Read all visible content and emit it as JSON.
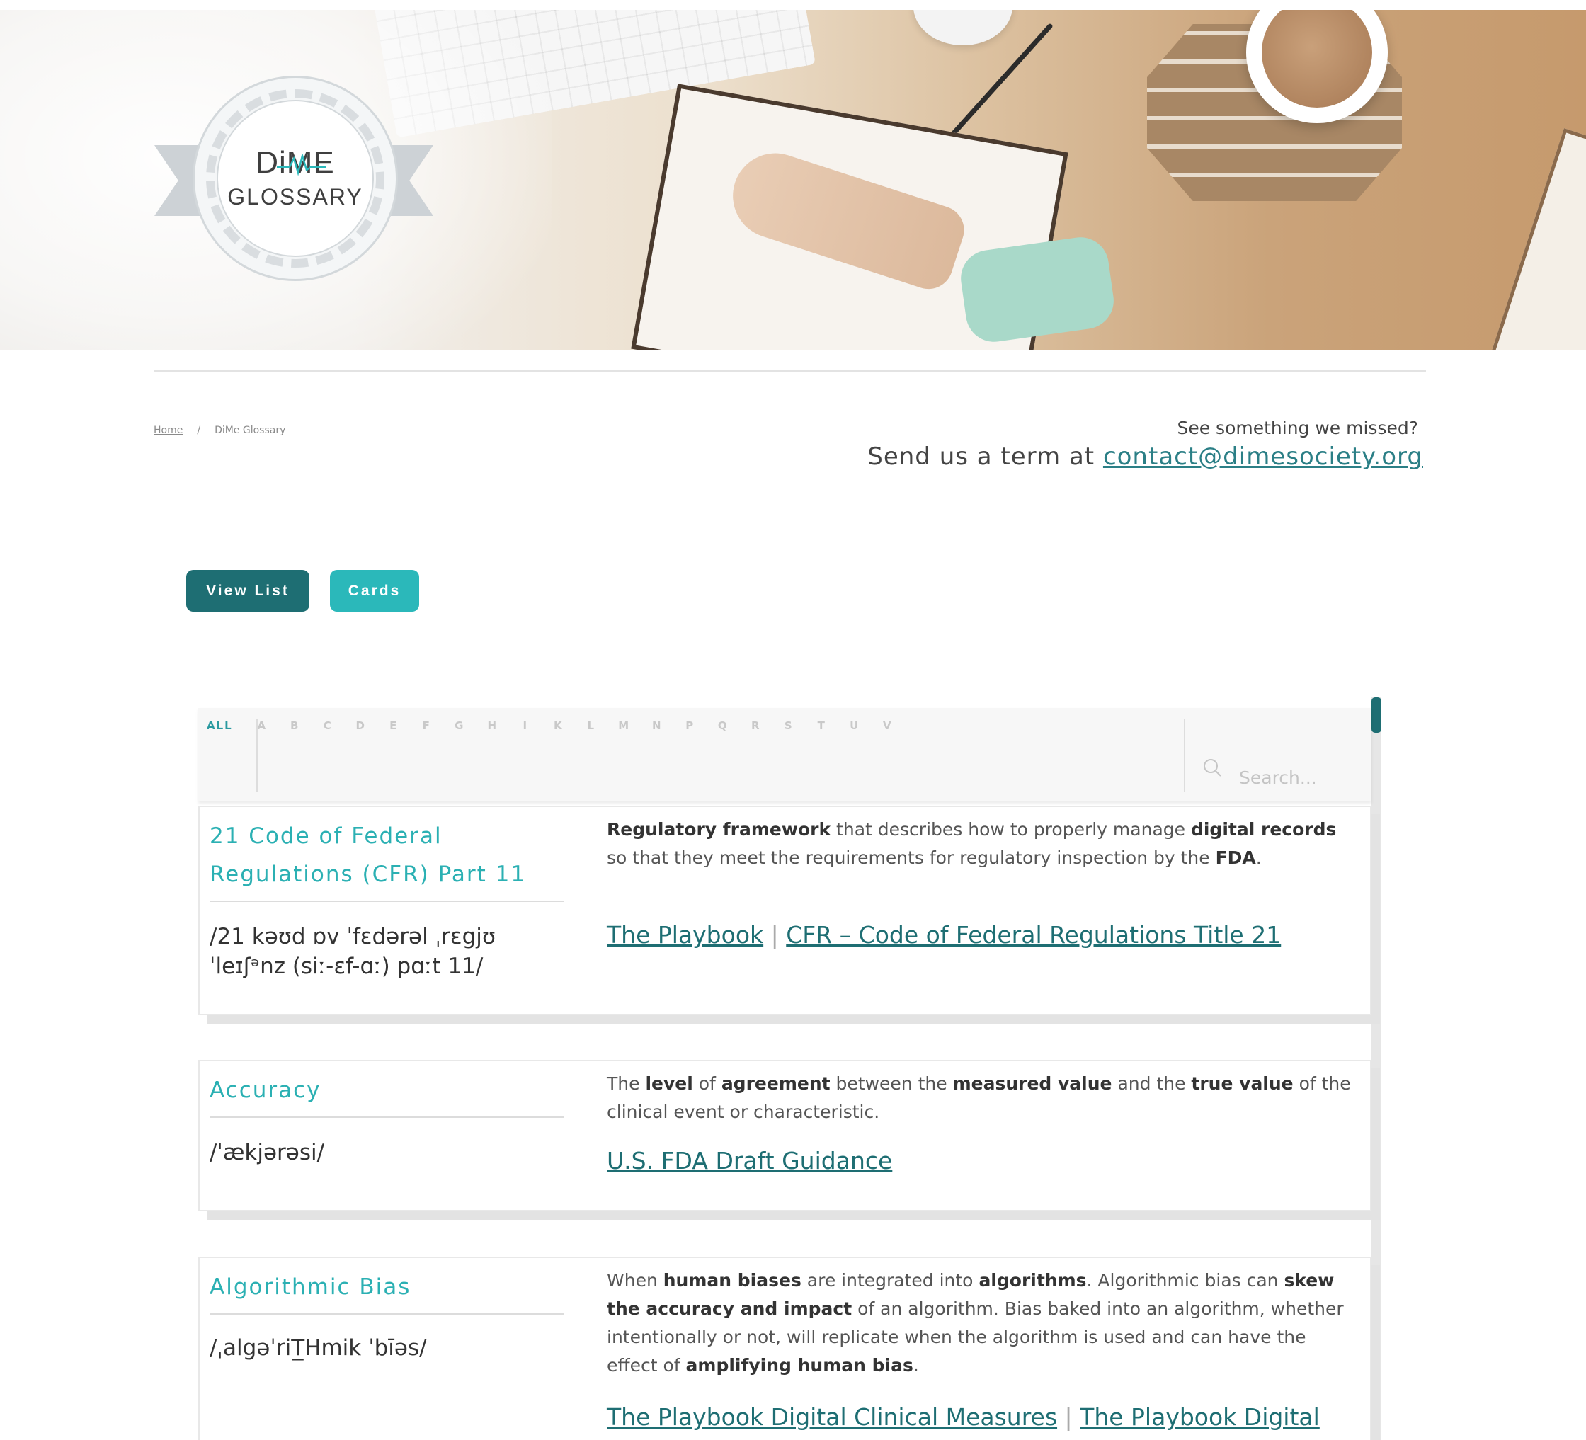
{
  "hero": {
    "logo_top": "DiME",
    "logo_bottom": "GLOSSARY"
  },
  "breadcrumb": {
    "home": "Home",
    "separator": "/",
    "current": "DiMe Glossary"
  },
  "contact": {
    "question": "See something we missed?",
    "prefix": "Send us a term at",
    "email": "contact@dimesociety.org"
  },
  "views": {
    "list_label": "View List",
    "cards_label": "Cards"
  },
  "filter": {
    "all_label": "ALL",
    "letters": [
      "A",
      "B",
      "C",
      "D",
      "E",
      "F",
      "G",
      "H",
      "I",
      "K",
      "L",
      "M",
      "N",
      "P",
      "Q",
      "R",
      "S",
      "T",
      "U",
      "V"
    ],
    "search_placeholder": "Search..."
  },
  "terms": [
    {
      "term": "21 Code of Federal Regulations (CFR) Part 11",
      "pronunciation": "/21 kəʊd ɒv ˈfɛdərəl ˌrɛgjʊˈleɪʃᵊnz (siː-ɛf-ɑː) pɑːt 11/",
      "definition_parts": [
        {
          "text": "Regulatory framework",
          "bold": true
        },
        {
          "text": " that describes how to properly manage ",
          "bold": false
        },
        {
          "text": "digital records",
          "bold": true
        },
        {
          "text": " so that they meet the requirements for regulatory inspection by the ",
          "bold": false
        },
        {
          "text": "FDA",
          "bold": true
        },
        {
          "text": ".",
          "bold": false
        }
      ],
      "references": [
        "The Playbook",
        "CFR – Code of Federal Regulations Title 21"
      ]
    },
    {
      "term": "Accuracy",
      "pronunciation": "/ˈækjərəsi/",
      "definition_parts": [
        {
          "text": "The ",
          "bold": false
        },
        {
          "text": "level",
          "bold": true
        },
        {
          "text": " of ",
          "bold": false
        },
        {
          "text": "agreement",
          "bold": true
        },
        {
          "text": " between the ",
          "bold": false
        },
        {
          "text": "measured value",
          "bold": true
        },
        {
          "text": " and the ",
          "bold": false
        },
        {
          "text": "true value",
          "bold": true
        },
        {
          "text": " of the clinical event or characteristic.",
          "bold": false
        }
      ],
      "references": [
        "U.S. FDA Draft Guidance"
      ]
    },
    {
      "term": "Algorithmic Bias",
      "pronunciation": "/ˌalgəˈriT̲Hmik ˈbīəs/",
      "definition_parts": [
        {
          "text": "When ",
          "bold": false
        },
        {
          "text": "human biases",
          "bold": true
        },
        {
          "text": " are integrated into ",
          "bold": false
        },
        {
          "text": "algorithms",
          "bold": true
        },
        {
          "text": ". Algorithmic bias can ",
          "bold": false
        },
        {
          "text": "skew the accuracy and impact",
          "bold": true
        },
        {
          "text": " of an algorithm. Bias baked into an algorithm, whether intentionally or not, will replicate when the algorithm is used and can have the effect of ",
          "bold": false
        },
        {
          "text": "amplifying human bias",
          "bold": true
        },
        {
          "text": ".",
          "bold": false
        }
      ],
      "references": [
        "The Playbook Digital Clinical Measures",
        "The Playbook Digital"
      ]
    }
  ],
  "colors": {
    "teal_dark": "#1e6e73",
    "teal_light": "#2bb8ba",
    "term_color": "#2bb0b3"
  }
}
